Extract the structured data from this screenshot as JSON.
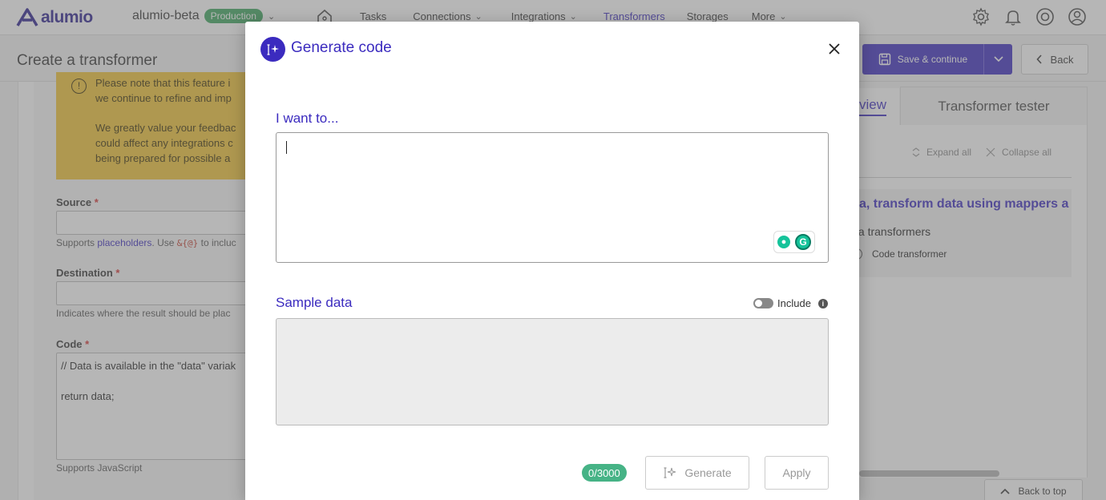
{
  "topnav": {
    "logo": "alumio",
    "workspace": "alumio-beta",
    "environment": "Production",
    "items": [
      {
        "label": "Tasks",
        "has_menu": false,
        "active": false
      },
      {
        "label": "Connections",
        "has_menu": true,
        "active": false
      },
      {
        "label": "Integrations",
        "has_menu": true,
        "active": false
      },
      {
        "label": "Transformers",
        "has_menu": false,
        "active": true
      },
      {
        "label": "Storages",
        "has_menu": false,
        "active": false
      },
      {
        "label": "More",
        "has_menu": true,
        "active": false
      }
    ],
    "icons": [
      "settings-icon",
      "bell-icon",
      "help-icon",
      "user-icon"
    ]
  },
  "header": {
    "title": "Create a transformer",
    "save_label": "Save & continue",
    "back_label": "Back"
  },
  "form": {
    "warning": {
      "line1": "Please note that this feature i",
      "line2": "we continue to refine and imp",
      "line3": "We greatly value your feedbac",
      "line4": "could affect any integrations c",
      "line5": "being prepared for possible a"
    },
    "source": {
      "label": "Source",
      "required": "*",
      "value": "",
      "help_prefix": "Supports",
      "help_link": "placeholders",
      "help_mid": ". Use",
      "help_code": "&{@}",
      "help_suffix": "to incluc"
    },
    "destination": {
      "label": "Destination",
      "required": "*",
      "value": "",
      "help": "Indicates where the result should be plac"
    },
    "code": {
      "label": "Code",
      "required": "*",
      "line1": "// Data is available in the \"data\" variak",
      "line2": "return data;",
      "help": "Supports JavaScript"
    }
  },
  "right_panel": {
    "tab_overview": "view",
    "tab_tester": "Transformer tester",
    "expand_all": "Expand all",
    "collapse_all": "Collapse all",
    "tree_title": "a, transform data using mappers a",
    "tree_sub": "ta transformers",
    "tree_item": "Code transformer",
    "back_to_top": "Back to top"
  },
  "modal": {
    "title": "Generate code",
    "want_label": "I want to...",
    "want_value": "",
    "sample_label": "Sample data",
    "include_label": "Include",
    "include_on": false,
    "counter": "0/3000",
    "generate_label": "Generate",
    "apply_label": "Apply"
  },
  "colors": {
    "brand": "#3b2bbf",
    "production_badge": "#3ba55c",
    "warning_bg": "#f1c232",
    "counter_badge": "#46b386"
  }
}
